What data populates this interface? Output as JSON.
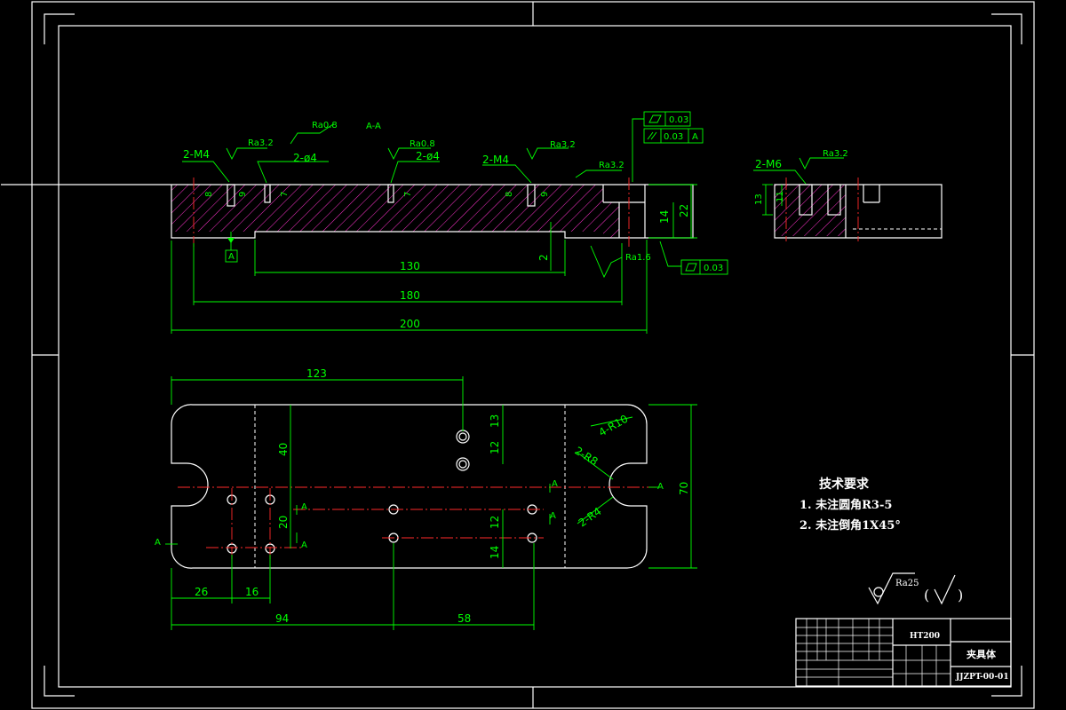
{
  "views": {
    "section": {
      "title": "A-A",
      "dims": {
        "overall": "200",
        "between_holes": "180",
        "pocket": "130",
        "pocket_depth": "2",
        "height": "22",
        "step": "14",
        "c8a": "8",
        "c9a": "9",
        "c7a": "7",
        "c7b": "7",
        "c8b": "8",
        "c9b": "9"
      },
      "callouts": {
        "m4_left": "2-M4",
        "d4_left": "2-ø4",
        "d4_mid": "2-ø4",
        "m4_right": "2-M4"
      },
      "roughness": {
        "r1": "Ra3.2",
        "r2": "Ra0.8",
        "r3": "Ra0.8",
        "r4": "Ra3.2",
        "r5": "Ra3.2",
        "r6": "Ra1.6"
      },
      "datum": "A",
      "tol": {
        "flat1_val": "0.03",
        "par_val": "0.03",
        "par_datum": "A",
        "flat2_val": "0.03"
      }
    },
    "side": {
      "callout": "2-M6",
      "roughness": "Ra3.2",
      "d13": "13",
      "d11": "11"
    },
    "plan": {
      "dims": {
        "d123": "123",
        "d13": "13",
        "d12a": "12",
        "d40": "40",
        "d20": "20",
        "d12b": "12",
        "d14": "14",
        "d70": "70",
        "d26": "26",
        "d16": "16",
        "d94": "94",
        "d58": "58"
      },
      "radii": {
        "r10": "4-R10",
        "r8": "2-R8",
        "r4": "2-R4"
      },
      "section_marks": {
        "left": "A",
        "right": "A",
        "mid_top": "A",
        "mid_bot": "A",
        "mid_right": "A",
        "top_right": "A"
      }
    }
  },
  "notes": {
    "title": "技术要求",
    "lines": [
      "1. 未注圆角R3-5",
      "2. 未注倒角1X45°"
    ]
  },
  "general_roughness": {
    "label": "Ra25",
    "paren_left": "(",
    "paren_right": ")"
  },
  "title_block": {
    "material": "HT200",
    "name": "夹具体",
    "drawing_no": "JJZPT-00-01"
  }
}
